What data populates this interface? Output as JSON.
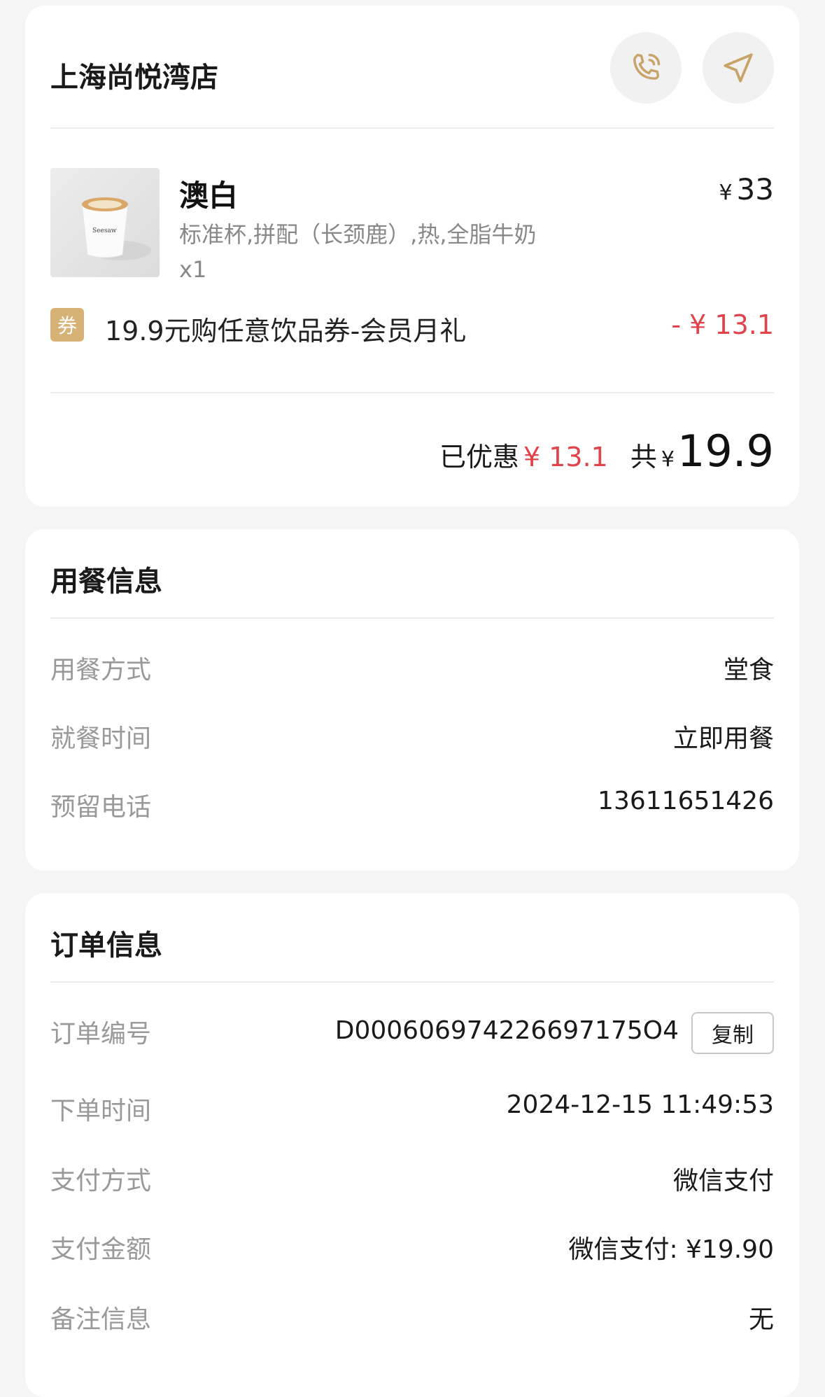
{
  "store": {
    "name": "上海尚悦湾店",
    "phone_icon": "phone-icon",
    "nav_icon": "navigation-arrow-icon",
    "accent_color": "#c9a46a"
  },
  "item": {
    "name": "澳白",
    "price_symbol": "¥",
    "price": "33",
    "spec": "标准杯,拼配（长颈鹿）,热,全脂牛奶",
    "quantity": "x1",
    "image_icon": "coffee-cup-image"
  },
  "coupon": {
    "badge": "券",
    "title": "19.9元购任意饮品券-会员月礼",
    "amount": "- ¥ 13.1"
  },
  "summary": {
    "discount_label": "已优惠",
    "discount_value": "¥ 13.1",
    "total_label": "共",
    "total_symbol": "¥",
    "total_value": "19.9"
  },
  "dining": {
    "title": "用餐信息",
    "rows": [
      {
        "label": "用餐方式",
        "value": "堂食"
      },
      {
        "label": "就餐时间",
        "value": "立即用餐"
      },
      {
        "label": "预留电话",
        "value": "13611651426"
      }
    ]
  },
  "order": {
    "title": "订单信息",
    "copy_label": "复制",
    "rows": [
      {
        "label": "订单编号",
        "value": "D000606974226697175O4"
      },
      {
        "label": "下单时间",
        "value": "2024-12-15 11:49:53"
      },
      {
        "label": "支付方式",
        "value": "微信支付"
      },
      {
        "label": "支付金额",
        "value": "微信支付: ¥19.90"
      },
      {
        "label": "备注信息",
        "value": "无"
      }
    ]
  },
  "colors": {
    "discount_red": "#e0434a",
    "badge_gold": "#d6b277"
  }
}
